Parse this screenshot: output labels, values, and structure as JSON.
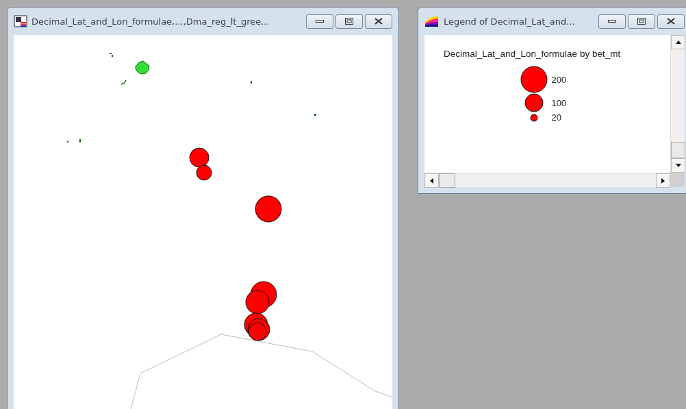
{
  "map_window": {
    "title": "Decimal_Lat_and_Lon_formulae,...,Dma_reg_lt_gree..."
  },
  "legend_window": {
    "title": "Legend of Decimal_Lat_and...",
    "heading": "Decimal_Lat_and_Lon_formulae by bet_mt",
    "entries": [
      {
        "label": "200"
      },
      {
        "label": "100"
      },
      {
        "label": "20"
      }
    ]
  }
}
